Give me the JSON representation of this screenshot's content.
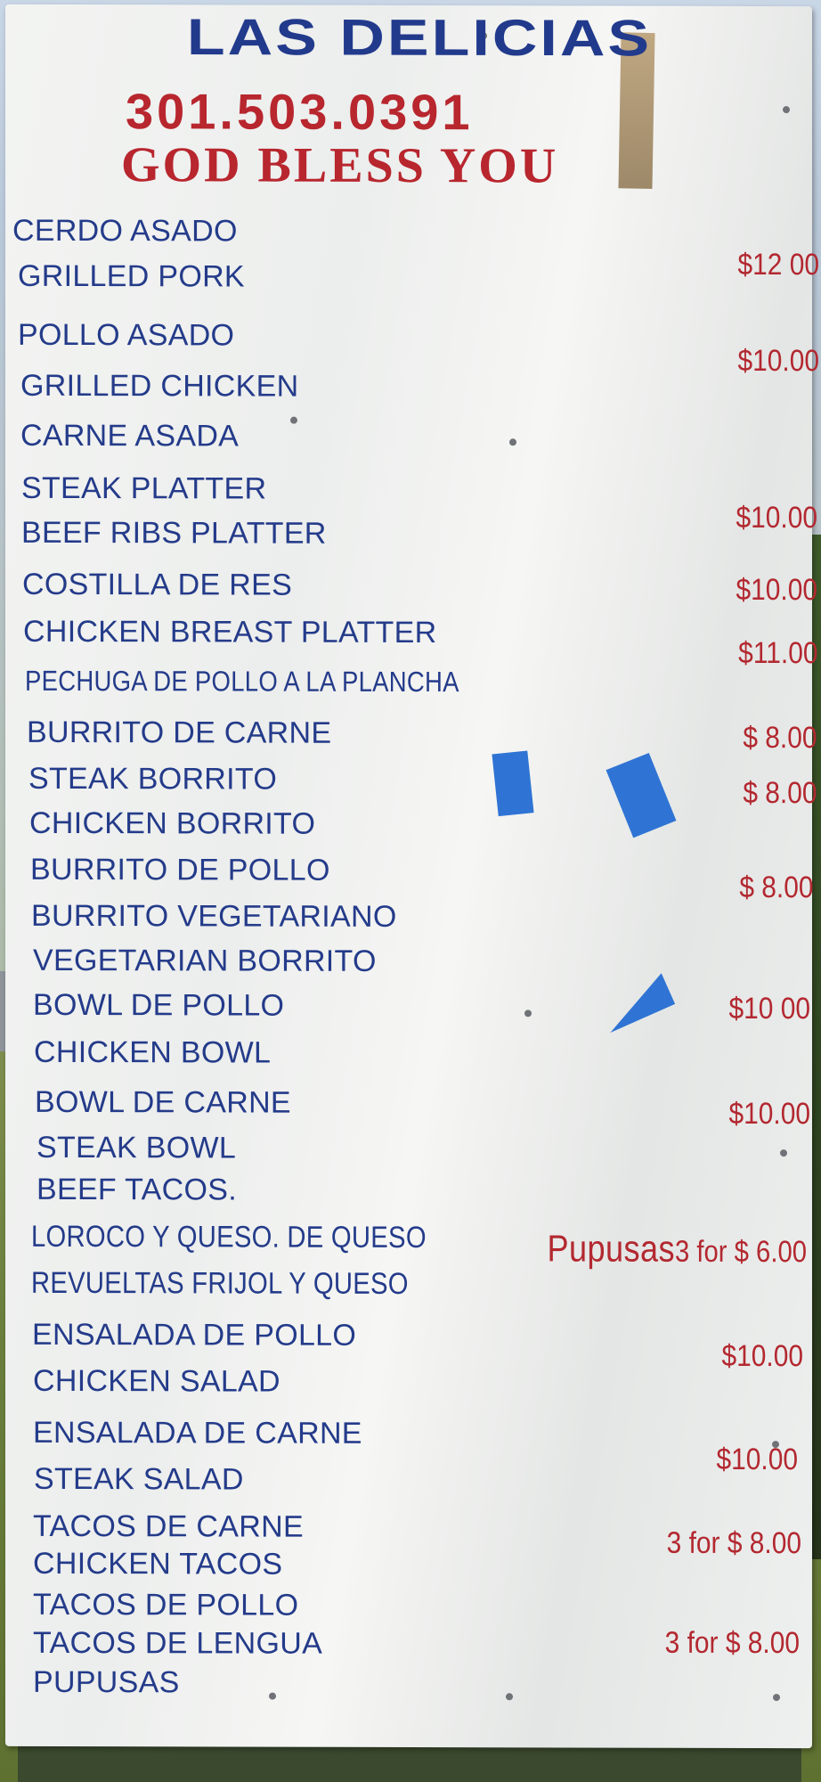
{
  "sign": {
    "name": "LAS DELICIAS",
    "phone": "301.503.0391",
    "blessing": "GOD BLESS YOU"
  },
  "menu_items": [
    "CERDO ASADO",
    "GRILLED PORK",
    "POLLO ASADO",
    "GRILLED CHICKEN",
    "CARNE ASADA",
    "STEAK PLATTER",
    "BEEF RIBS PLATTER",
    "COSTILLA DE RES",
    "CHICKEN BREAST PLATTER",
    "PECHUGA DE POLLO A LA PLANCHA",
    "BURRITO DE CARNE",
    "STEAK BORRITO",
    "CHICKEN BORRITO",
    "BURRITO DE POLLO",
    "BURRITO VEGETARIANO",
    "VEGETARIAN BORRITO",
    "BOWL DE POLLO",
    "CHICKEN BOWL",
    "BOWL DE CARNE",
    "STEAK BOWL",
    "BEEF TACOS.",
    "LOROCO Y QUESO. DE QUESO",
    "REVUELTAS  FRIJOL Y QUESO",
    "ENSALADA DE POLLO",
    "CHICKEN SALAD",
    "ENSALADA DE CARNE",
    "STEAK SALAD",
    "TACOS DE CARNE",
    "CHICKEN TACOS",
    "TACOS DE POLLO",
    "TACOS DE LENGUA",
    "PUPUSAS"
  ],
  "prices": [
    "$12 00",
    "$10.00",
    "$10.00",
    "$10.00",
    "$11.00",
    "$ 8.00",
    "$ 8.00",
    "$ 8.00",
    "$10 00",
    "$10.00",
    "$10.00",
    "$10.00",
    "3 for $ 8.00",
    "3 for $  8.00"
  ],
  "pupusas_price": {
    "word": "Pupusas",
    "deal": "3 for $ 6.00"
  },
  "colors": {
    "item_text": "#243b8a",
    "price_text": "#b32830",
    "title_blue": "#223a8c",
    "title_red": "#b8262e",
    "board": "#f1f2f0"
  }
}
